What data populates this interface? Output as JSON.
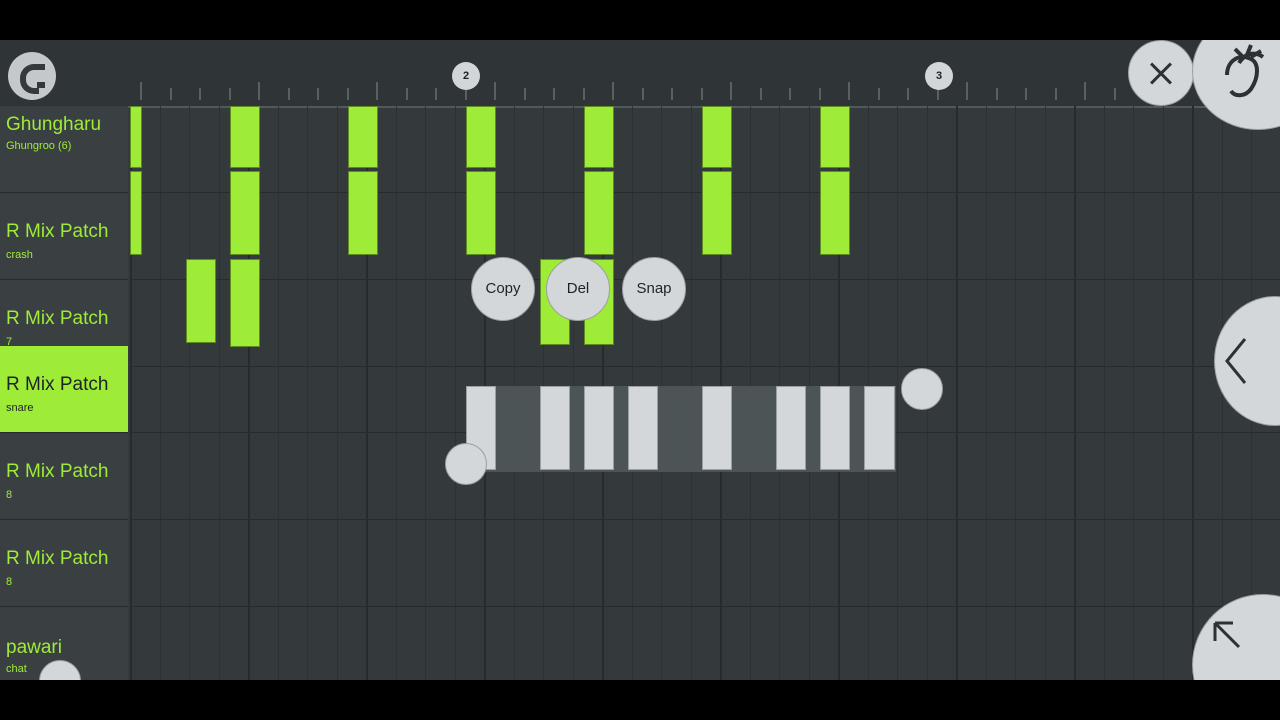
{
  "ruler": {
    "bar_markers": [
      "2",
      "3"
    ]
  },
  "tracks": [
    {
      "name": "Ghungharu",
      "sub": "Ghungroo (6)",
      "selected": false
    },
    {
      "name": "R Mix Patch",
      "sub": "crash",
      "selected": false
    },
    {
      "name": "R Mix Patch",
      "sub": "7",
      "selected": false
    },
    {
      "name": "R Mix Patch",
      "sub": "snare",
      "selected": true
    },
    {
      "name": "R Mix Patch",
      "sub": "8",
      "selected": false
    },
    {
      "name": "R Mix Patch",
      "sub": "8",
      "selected": false
    },
    {
      "name": "pawari",
      "sub": "chat",
      "selected": false
    }
  ],
  "selection_menu": {
    "copy": "Copy",
    "delete": "Del",
    "snap": "Snap"
  },
  "icons": {
    "magnet": "magnet-icon",
    "close": "close-icon",
    "logo": "fruit-logo-icon",
    "chevron": "chevron-left-icon",
    "expand": "arrow-up-left-icon"
  },
  "colors": {
    "accent": "#9eeb38",
    "background": "#343a3c",
    "selection": "#d3d7d9"
  }
}
